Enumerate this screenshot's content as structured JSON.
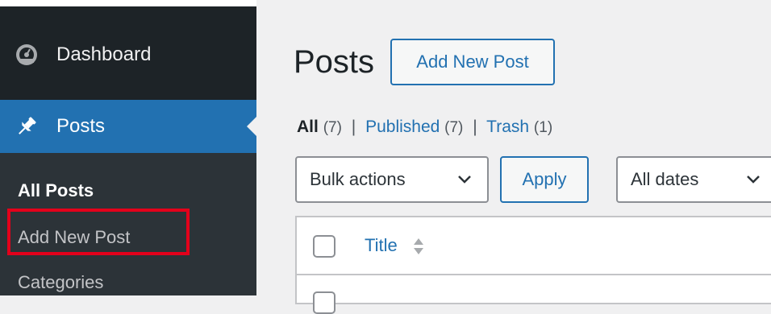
{
  "sidebar": {
    "dashboard_label": "Dashboard",
    "posts_label": "Posts",
    "submenu": {
      "all_posts": "All Posts",
      "add_new_post": "Add New Post",
      "categories": "Categories"
    },
    "icons": {
      "dashboard": "dashboard-gauge-icon",
      "posts": "pushpin-icon"
    }
  },
  "main": {
    "page_title": "Posts",
    "add_new_button": "Add New Post",
    "filters": {
      "all_label": "All",
      "all_count": "(7)",
      "published_label": "Published",
      "published_count": "(7)",
      "trash_label": "Trash",
      "trash_count": "(1)",
      "separator": "|"
    },
    "bulk_actions": {
      "selected": "Bulk actions",
      "apply": "Apply"
    },
    "date_filter": {
      "selected": "All dates"
    },
    "table": {
      "title_column": "Title"
    }
  },
  "colors": {
    "sidebar_bg": "#1d2327",
    "active_menu": "#2271b1",
    "link": "#2271b1",
    "highlight_border": "#e3001b"
  }
}
